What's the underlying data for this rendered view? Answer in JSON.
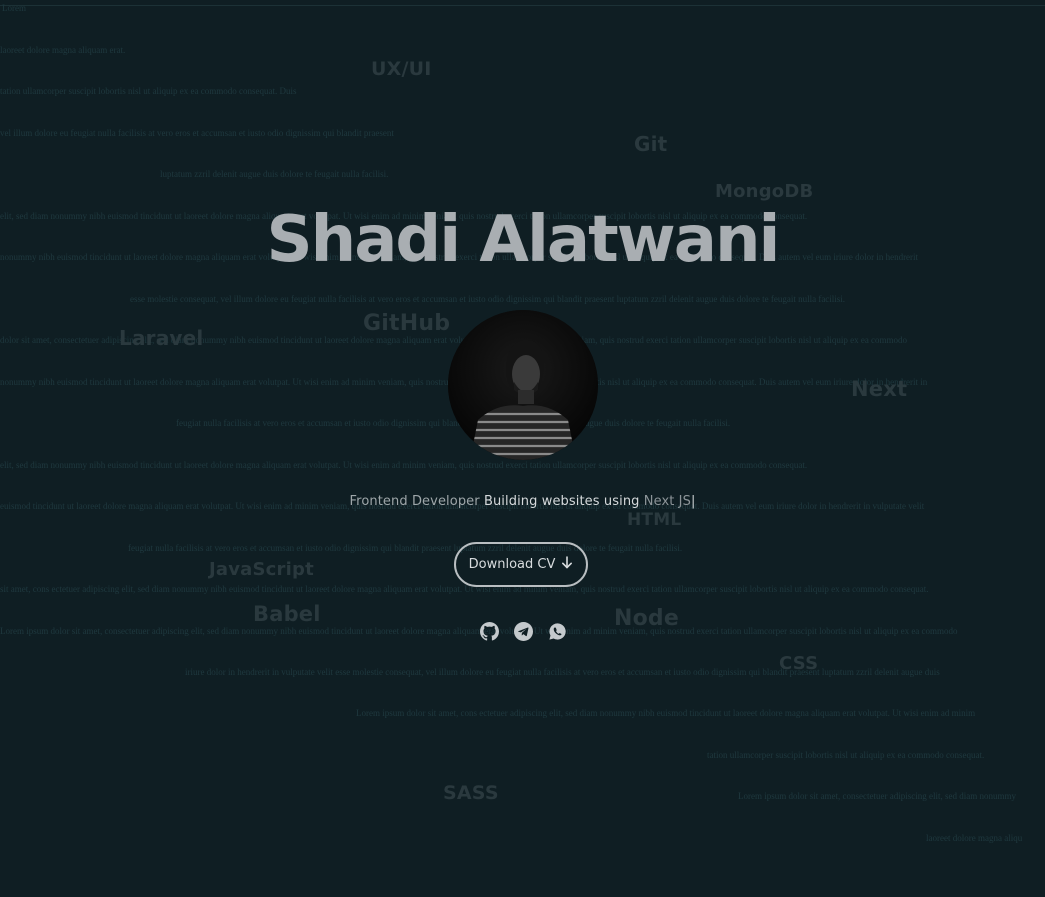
{
  "background_text": [
    "Lorem",
    "laoreet dolore magna aliquam erat.",
    "tation ullamcorper suscipit lobortis nisl ut aliquip ex ea commodo consequat. Duis",
    "vel illum dolore eu feugiat nulla facilisis at vero eros et accumsan et iusto odio dignissim qui blandit praesent",
    "luptatum zzril delenit augue duis dolore te feugait nulla facilisi.",
    "elit, sed diam nonummy nibh euismod tincidunt ut laoreet dolore magna aliquam erat volutpat. Ut wisi enim ad minim veniam, quis nostrud exerci tation ullamcorper suscipit lobortis nisl ut aliquip ex ea commodo consequat.",
    "nonummy nibh euismod tincidunt ut laoreet dolore magna aliquam erat volutpat. Ut wisi enim ad minim veniam, quis nostrud exerci tation ullamcorper suscipit lobortis nisl ut aliquip ex ea commodo consequat. Duis autem vel eum iriure dolor in hendrerit",
    "esse molestie consequat, vel illum dolore eu feugiat nulla facilisis at vero eros et accumsan et iusto odio dignissim qui blandit praesent luptatum zzril delenit augue duis dolore te feugait nulla facilisi.",
    "dolor sit amet, consectetuer adipiscing elit, sed diam nonummy nibh euismod tincidunt ut laoreet dolore magna aliquam erat volutpat. Ut wisi enim ad minim veniam, quis nostrud exerci tation ullamcorper suscipit lobortis nisl ut aliquip ex ea commodo",
    "nonummy nibh euismod tincidunt ut laoreet dolore magna aliquam erat volutpat. Ut wisi enim ad minim veniam, quis nostrud exerci tation ullamcorper suscipit lobortis nisl ut aliquip ex ea commodo consequat. Duis autem vel eum iriure dolor in hendrerit in",
    "feugiat nulla facilisis at vero eros et accumsan et iusto odio dignissim qui blandit praesent luptatum zzril delenit augue duis dolore te feugait nulla facilisi.",
    "elit, sed diam nonummy nibh euismod tincidunt ut laoreet dolore magna aliquam erat volutpat. Ut wisi enim ad minim veniam, quis nostrud exerci tation ullamcorper suscipit lobortis nisl ut aliquip ex ea commodo consequat.",
    "euismod tincidunt ut laoreet dolore magna aliquam erat volutpat. Ut wisi enim ad minim veniam, quis nostrud exerci tation ullamcorper suscipit lobortis nisl ut aliquip ex ea commodo consequat. Duis autem vel eum iriure dolor in hendrerit in vulputate velit",
    "feugiat nulla facilisis at vero eros et accumsan et iusto odio dignissim qui blandit praesent luptatum zzril delenit augue duis dolore te feugait nulla facilisi.",
    "sit amet, cons ectetuer adipiscing elit, sed diam nonummy nibh euismod tincidunt ut laoreet dolore magna aliquam erat volutpat. Ut wisi enim ad minim veniam, quis nostrud exerci tation ullamcorper suscipit lobortis nisl ut aliquip ex ea commodo consequat.",
    "Lorem ipsum dolor sit amet, consectetuer adipiscing elit, sed diam nonummy nibh euismod tincidunt ut laoreet dolore magna aliquam erat volutpat. Ut wisi enim ad minim veniam, quis nostrud exerci tation ullamcorper suscipit lobortis nisl ut aliquip ex ea commodo",
    "iriure dolor in hendrerit in vulputate velit esse molestie consequat, vel illum dolore eu feugiat nulla facilisis at vero eros et accumsan et iusto odio dignissim qui blandit praesent luptatum zzril delenit augue duis",
    "Lorem ipsum dolor sit amet, cons ectetuer adipiscing elit, sed diam nonummy nibh euismod tincidunt ut laoreet dolore magna aliquam erat volutpat. Ut wisi enim ad minim",
    "tation ullamcorper suscipit lobortis nisl ut aliquip ex ea commodo consequat.",
    "Lorem ipsum dolor sit amet, consectetuer adipiscing elit, sed diam nonummy",
    "laoreet dolore magna aliqu"
  ],
  "tech_words": [
    "UX/UI",
    "Git",
    "MongoDB",
    "GitHub",
    "Laravel",
    "Next",
    "HTML",
    "JavaScript",
    "Babel",
    "Node",
    "CSS",
    "SASS"
  ],
  "hero": {
    "name": "Shadi Alatwani",
    "tagline_role": "Frontend Developer",
    "tagline_main": "Building websites using",
    "tagline_tech": "Next JS",
    "cursor": "|"
  },
  "cta": {
    "download_cv_label": "Download CV"
  },
  "socials": [
    "github-icon",
    "telegram-icon",
    "whatsapp-icon"
  ],
  "colors": {
    "background": "#0f1e23",
    "title": "#a9aeb2",
    "tech_word": "#2a393e",
    "lorem": "#1f393f"
  }
}
